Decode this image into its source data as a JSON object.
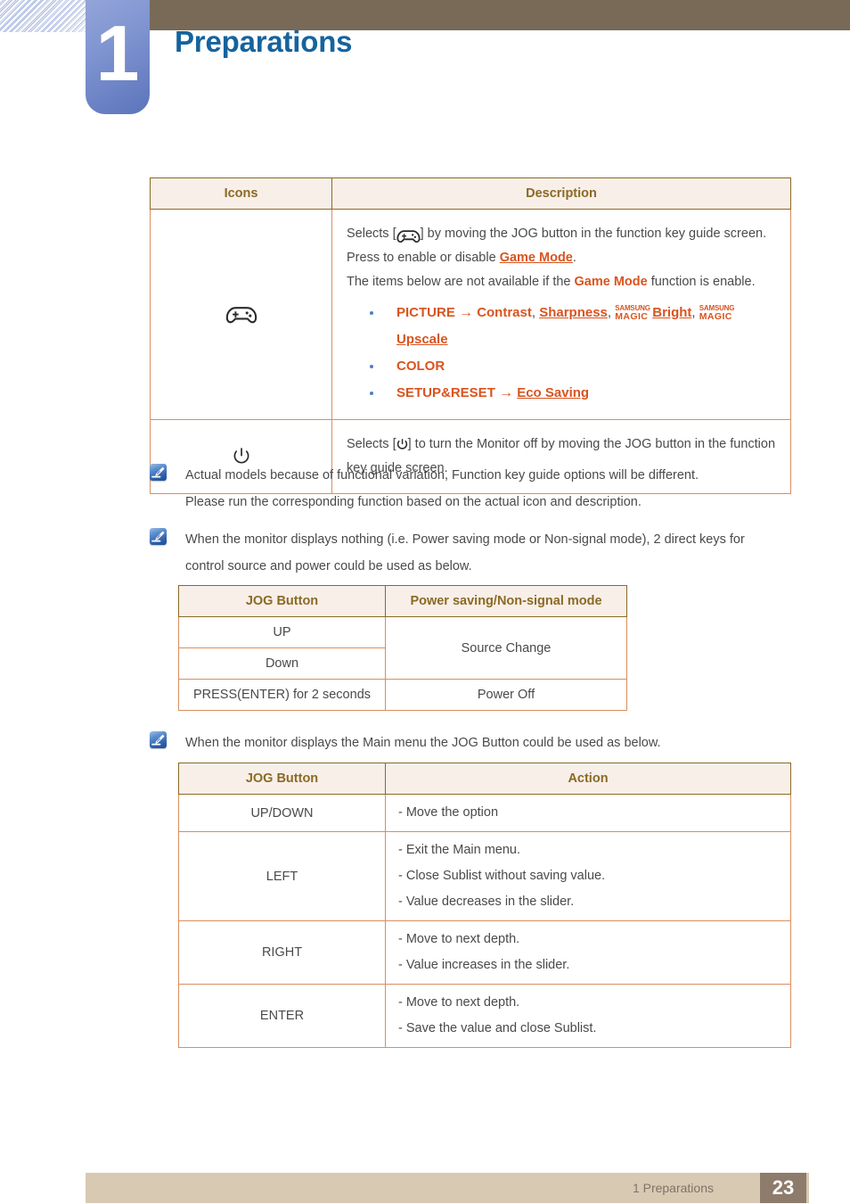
{
  "header": {
    "chapter_number": "1",
    "title": "Preparations"
  },
  "icons_table": {
    "columns": [
      "Icons",
      "Description"
    ],
    "rows": [
      {
        "icon": "gamepad-icon",
        "desc_line1_pre": "Selects [",
        "desc_line1_icon": "gamepad-icon",
        "desc_line1_post": "] by moving the JOG button in the function key guide screen.",
        "desc_line2_pre": "Press to enable or disable ",
        "desc_line2_link": "Game Mode",
        "desc_line2_post": ".",
        "desc_line3_pre": "The items below are not available if the ",
        "desc_line3_link": "Game Mode",
        "desc_line3_post": " function is enable.",
        "items": [
          {
            "label": "PICTURE",
            "arrow": "→",
            "parts": [
              "Contrast",
              "Sharpness",
              "Bright",
              "Upscale"
            ],
            "magic_top": "SAMSUNG",
            "magic_bottom": "MAGIC",
            "sep": ","
          },
          {
            "label": "COLOR"
          },
          {
            "label": "SETUP&RESET",
            "arrow": "→",
            "parts": [
              "Eco Saving"
            ]
          }
        ]
      },
      {
        "icon": "power-icon",
        "desc_pre": "Selects [",
        "desc_icon": "power-icon",
        "desc_post": "] to turn the Monitor off by moving the JOG button in the function key guide screen."
      }
    ]
  },
  "notes": [
    {
      "icon": "note-icon",
      "lines": [
        "Actual models because of functional variation, Function key guide options will be different.",
        "Please run the corresponding function based on the actual icon and description."
      ]
    },
    {
      "icon": "note-icon",
      "lines": [
        "When the monitor displays nothing (i.e. Power saving mode or Non-signal mode), 2 direct keys for",
        "control source and power could be used as below."
      ]
    },
    {
      "icon": "note-icon",
      "lines": [
        "When the monitor displays the Main menu the JOG Button could be used as below."
      ]
    }
  ],
  "jog_table_1": {
    "columns": [
      "JOG Button",
      "Power saving/Non-signal mode"
    ],
    "rows": [
      {
        "button": "UP",
        "mode": "Source Change"
      },
      {
        "button": "Down"
      },
      {
        "button": "PRESS(ENTER) for 2 seconds",
        "mode": "Power Off"
      }
    ]
  },
  "jog_table_2": {
    "columns": [
      "JOG Button",
      "Action"
    ],
    "rows": [
      {
        "button": "UP/DOWN",
        "actions": [
          "- Move the option"
        ]
      },
      {
        "button": "LEFT",
        "actions": [
          "- Exit the Main menu.",
          "- Close Sublist without saving value.",
          "- Value decreases in the slider."
        ]
      },
      {
        "button": "RIGHT",
        "actions": [
          "- Move to next depth.",
          "- Value increases in the slider."
        ]
      },
      {
        "button": "ENTER",
        "actions": [
          "- Move to next depth.",
          "- Save the value and close Sublist."
        ]
      }
    ]
  },
  "footer": {
    "label": "1 Preparations",
    "page_number": "23"
  },
  "colors": {
    "header_bar": "#786a57",
    "chapter_tab": "#6a81c4",
    "title": "#15639e",
    "table_border": "#8a6a24",
    "table_inner_border": "#d98f5f",
    "table_header_bg": "#f8efe9",
    "accent_orange": "#d9541f",
    "footer_bar": "#d8c9b3",
    "footer_page_box": "#8d7b6c"
  }
}
